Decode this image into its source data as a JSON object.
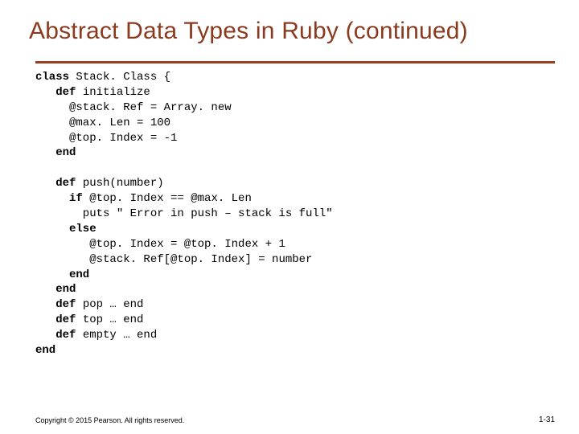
{
  "title": "Abstract Data Types in Ruby (continued)",
  "code": {
    "l01a": "class",
    "l01b": " Stack. Class {",
    "l02a": "   def ",
    "l02b": "initialize",
    "l03": "     @stack. Ref = Array. new",
    "l04": "     @max. Len = 100",
    "l05": "     @top. Index = -1",
    "l06a": "   end",
    "l07": "",
    "l08a": "   def ",
    "l08b": "push(number)",
    "l09a": "     if ",
    "l09b": "@top. Index == @max. Len",
    "l10": "       puts \" Error in push – stack is full\"",
    "l11a": "     else",
    "l12": "        @top. Index = @top. Index + 1",
    "l13": "        @stack. Ref[@top. Index] = number",
    "l14a": "     end",
    "l15a": "   end",
    "l16a": "   def ",
    "l16b": "pop … end",
    "l17a": "   def ",
    "l17b": "top … end",
    "l18a": "   def ",
    "l18b": "empty … end",
    "l19a": "end"
  },
  "footer": "Copyright © 2015 Pearson. All rights reserved.",
  "pagenum": "1-31"
}
